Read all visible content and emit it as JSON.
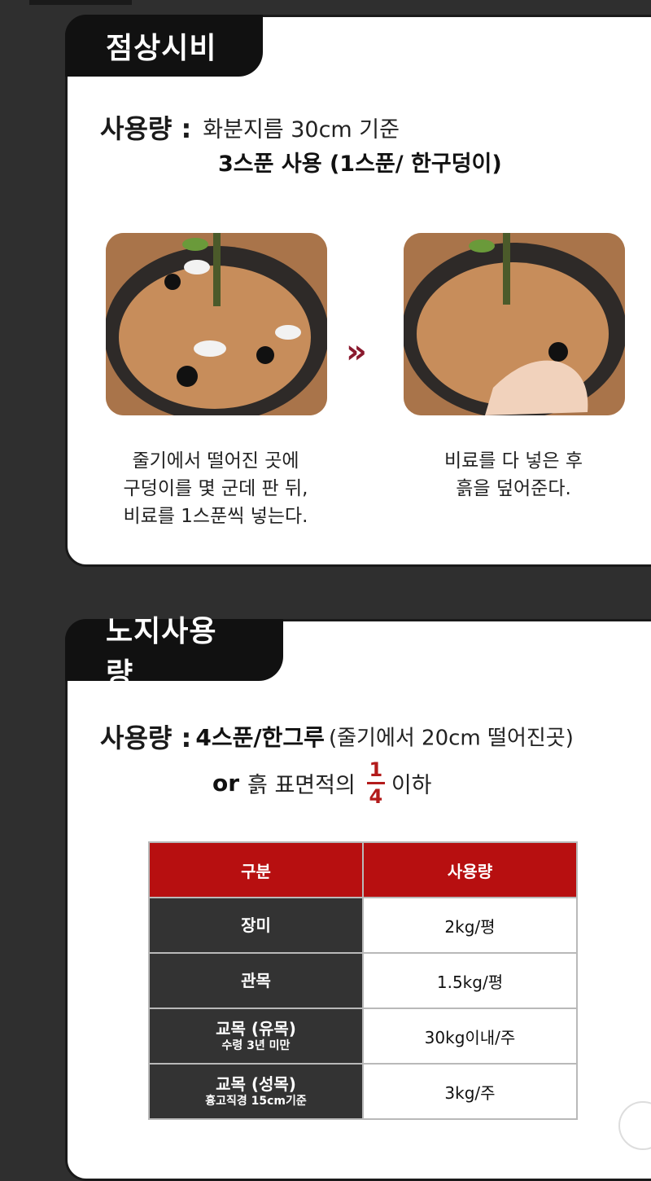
{
  "section1": {
    "title": "점상시비",
    "usage_label": "사용량 :",
    "usage_text": "화분지름 30cm 기준",
    "usage_sub": "3스푼 사용 (1스푼/ 한구덩이)",
    "steps": [
      {
        "caption_lines": [
          "줄기에서 떨어진 곳에",
          "구덩이를 몇 군데 판 뒤,",
          "비료를 1스푼씩 넣는다."
        ]
      },
      {
        "caption_lines": [
          "비료를 다 넣은 후",
          "흙을 덮어준다."
        ]
      }
    ],
    "arrow": "»"
  },
  "section2": {
    "title": "노지사용량",
    "usage_label": "사용량 :",
    "usage_bold": "4스푼/한그루",
    "usage_light": "(줄기에서 20cm 떨어진곳)",
    "or_label": "or",
    "or_text_before": "흙 표면적의",
    "fraction_num": "1",
    "fraction_den": "4",
    "or_text_after": "이하",
    "table": {
      "headers": [
        "구분",
        "사용량"
      ],
      "rows": [
        {
          "kind": "장미",
          "note": "",
          "amount": "2kg/평"
        },
        {
          "kind": "관목",
          "note": "",
          "amount": "1.5kg/평"
        },
        {
          "kind": "교목 (유목)",
          "note": "수령 3년 미만",
          "amount": "30kg이내/주"
        },
        {
          "kind": "교목 (성목)",
          "note": "흉고직경 15cm기준",
          "amount": "3kg/주"
        }
      ]
    }
  },
  "colors": {
    "accent_red": "#b70f10",
    "dark_cell": "#333333",
    "background": "#2f2f2f"
  }
}
